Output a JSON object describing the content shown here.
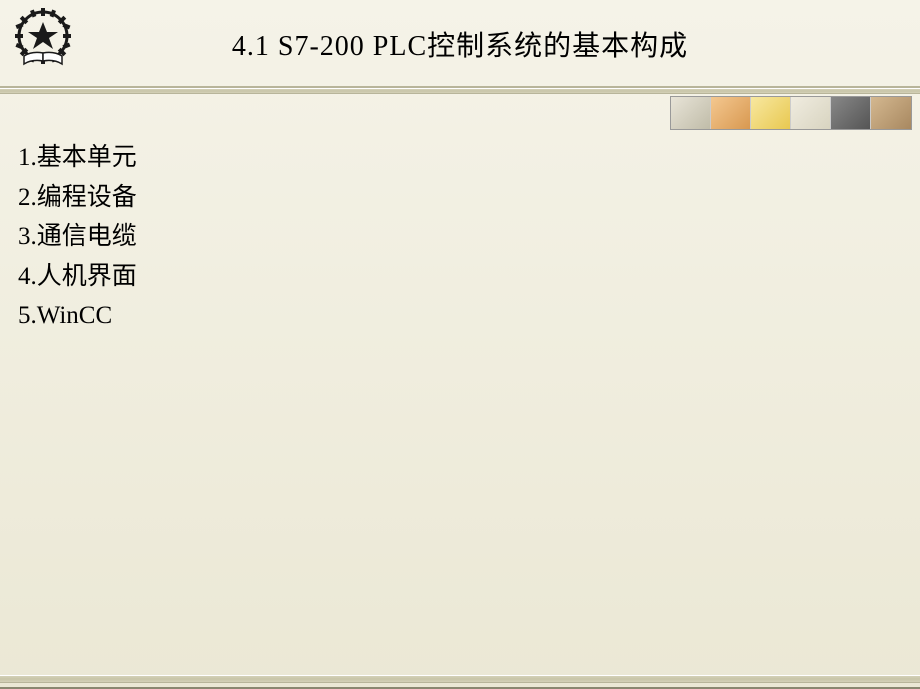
{
  "title": "4.1   S7-200 PLC控制系统的基本构成",
  "list": {
    "item1": "1.基本单元",
    "item2": "2.编程设备",
    "item3": "3.通信电缆",
    "item4": "4.人机界面",
    "item5": "5.WinCC"
  },
  "icons": {
    "i1": "decorative-tile-1",
    "i2": "decorative-tile-2",
    "i3": "decorative-tile-3",
    "i4": "decorative-tile-4",
    "i5": "decorative-tile-5",
    "i6": "decorative-tile-6"
  }
}
